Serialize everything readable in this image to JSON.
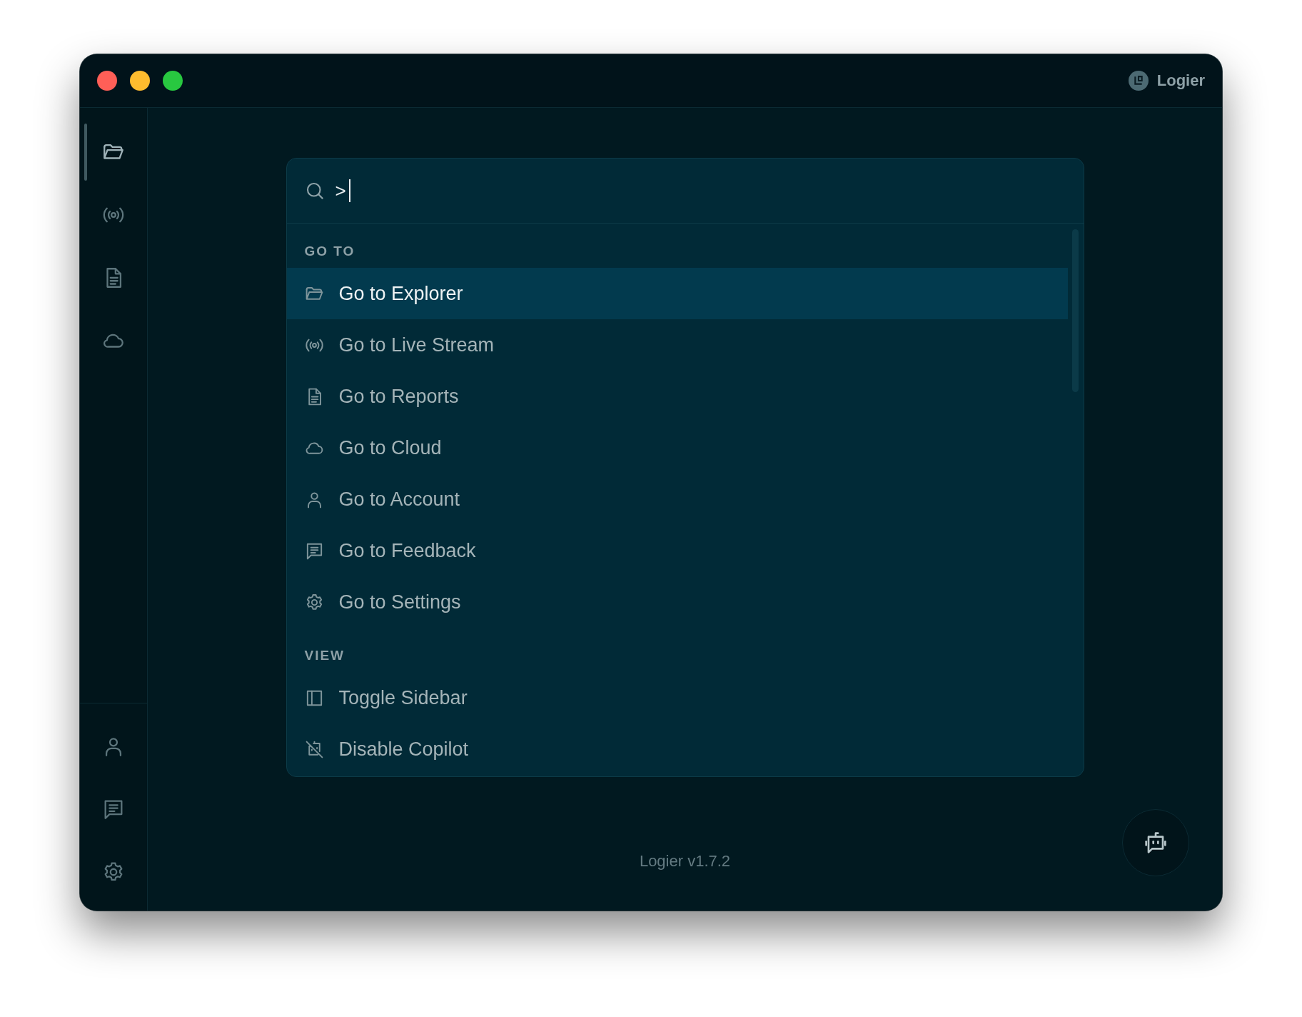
{
  "window": {
    "account_name": "Logier"
  },
  "sidebar": {
    "top_items": [
      {
        "kind": "folder",
        "selected": true
      },
      {
        "kind": "broadcast",
        "selected": false
      },
      {
        "kind": "document",
        "selected": false
      },
      {
        "kind": "cloud",
        "selected": false
      }
    ],
    "bottom_items": [
      {
        "kind": "person",
        "selected": false
      },
      {
        "kind": "message",
        "selected": false
      },
      {
        "kind": "gear",
        "selected": false
      }
    ]
  },
  "command_palette": {
    "search": {
      "value": ">"
    },
    "sections": [
      {
        "title": "GO TO",
        "items": [
          {
            "label": "Go to Explorer",
            "kind": "folder",
            "selected": true
          },
          {
            "label": "Go to Live Stream",
            "kind": "broadcast",
            "selected": false
          },
          {
            "label": "Go to Reports",
            "kind": "document",
            "selected": false
          },
          {
            "label": "Go to Cloud",
            "kind": "cloud",
            "selected": false
          },
          {
            "label": "Go to Account",
            "kind": "person",
            "selected": false
          },
          {
            "label": "Go to Feedback",
            "kind": "message",
            "selected": false
          },
          {
            "label": "Go to Settings",
            "kind": "gear",
            "selected": false
          }
        ]
      },
      {
        "title": "VIEW",
        "items": [
          {
            "label": "Toggle Sidebar",
            "kind": "sidebar",
            "selected": false
          },
          {
            "label": "Disable Copilot",
            "kind": "bot-off",
            "selected": false
          }
        ]
      }
    ]
  },
  "footer": {
    "version": "Logier v1.7.2"
  }
}
